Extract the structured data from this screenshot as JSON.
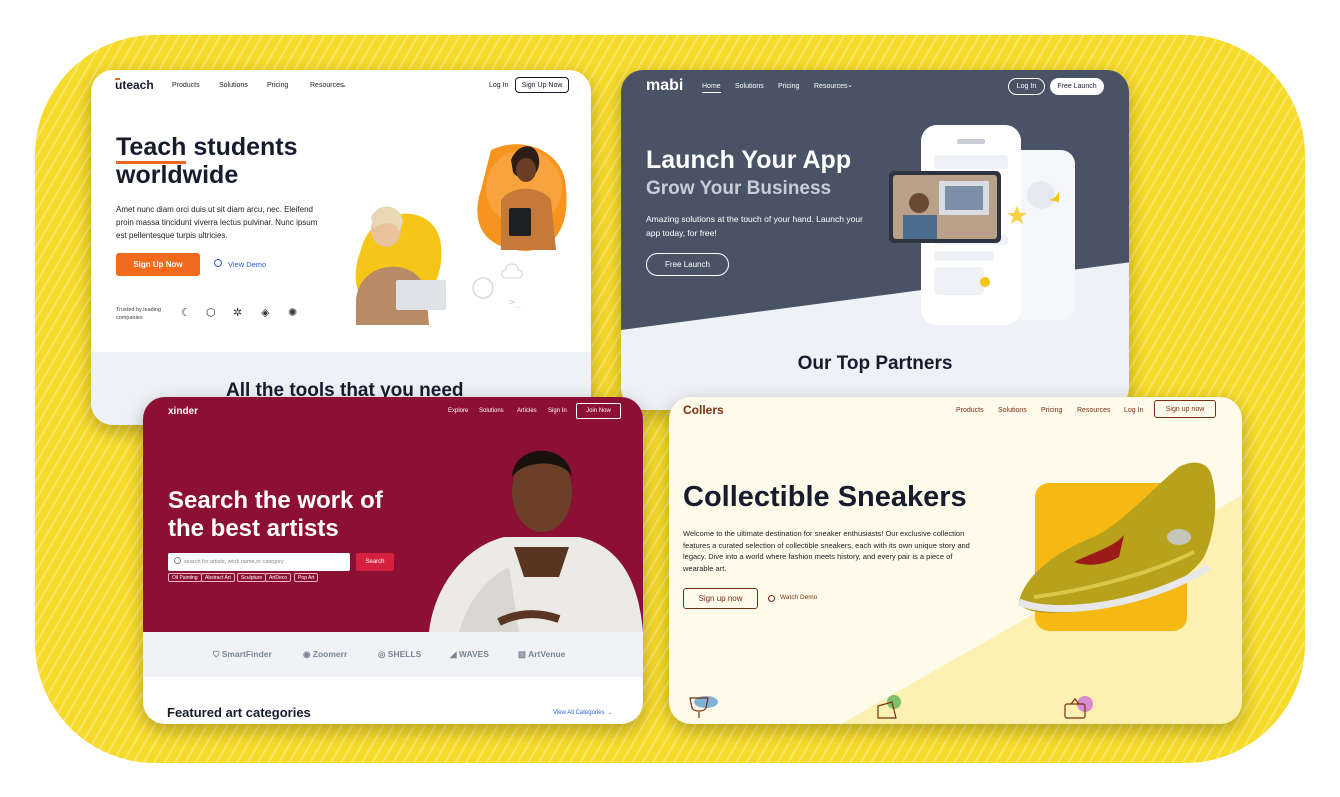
{
  "uteach": {
    "logo": "uteach",
    "nav": [
      "Products",
      "Solutions",
      "Pricing",
      "Resources"
    ],
    "login": "Log In",
    "signup_btn": "Sign Up Now",
    "headline_word1": "Teach",
    "headline_rest": " students worldwide",
    "description": "Amet nunc diam orci duis ut sit diam arcu, nec. Eleifend proin massa tincidunt viverra lectus pulvinar. Nunc ipsum est pellentesque turpis ultricies.",
    "cta_signup": "Sign Up Now",
    "cta_demo": "View Demo",
    "trusted_by": "Trusted by leading companies",
    "band_title": "All the tools that you need"
  },
  "mabi": {
    "logo": "mabi",
    "nav": [
      "Home",
      "Solutions",
      "Pricing",
      "Resources"
    ],
    "login": "Log In",
    "free_launch_btn": "Free Launch",
    "headline": "Launch Your App",
    "subheadline": "Grow Your Business",
    "description": "Amazing solutions at the touch of your hand. Launch your app today, for free!",
    "cta": "Free Launch",
    "partners_title": "Our Top Partners"
  },
  "xinder": {
    "logo": "xinder",
    "nav": [
      "Explore",
      "Solutions",
      "Articles"
    ],
    "signin": "Sign In",
    "join_btn": "Join Now",
    "headline": "Search the work of the best artists",
    "search_placeholder": "search for artists, work name,or category",
    "search_btn": "Search",
    "tags": [
      "Oil Painting",
      "Abstract Art",
      "Sculpture",
      "ArtDeco",
      "Pop Art"
    ],
    "partners": [
      "SmartFinder",
      "Zoomerr",
      "SHELLS",
      "WAVES",
      "ArtVenue"
    ],
    "featured_title": "Featured art categories",
    "view_all": "View All Categories"
  },
  "collers": {
    "logo": "Collers",
    "nav": [
      "Products",
      "Solutions",
      "Pricing",
      "Resources"
    ],
    "login": "Log In",
    "signup_btn": "Sign up now",
    "headline": "Collectible Sneakers",
    "description": "Welcome to the ultimate destination for sneaker enthusiasts! Our exclusive collection features a curated selection of collectible sneakers, each with its own unique story and legacy. Dive into a world where fashion meets history, and every pair is a piece of wearable art.",
    "cta_signup": "Sign up now",
    "cta_demo": "Watch Demo"
  },
  "colors": {
    "yellow": "#f7db2a",
    "uteach_orange": "#f26a1b",
    "mabi_slate": "#4a5366",
    "xinder_maroon": "#8c1034",
    "collers_brown": "#7a2d12"
  }
}
